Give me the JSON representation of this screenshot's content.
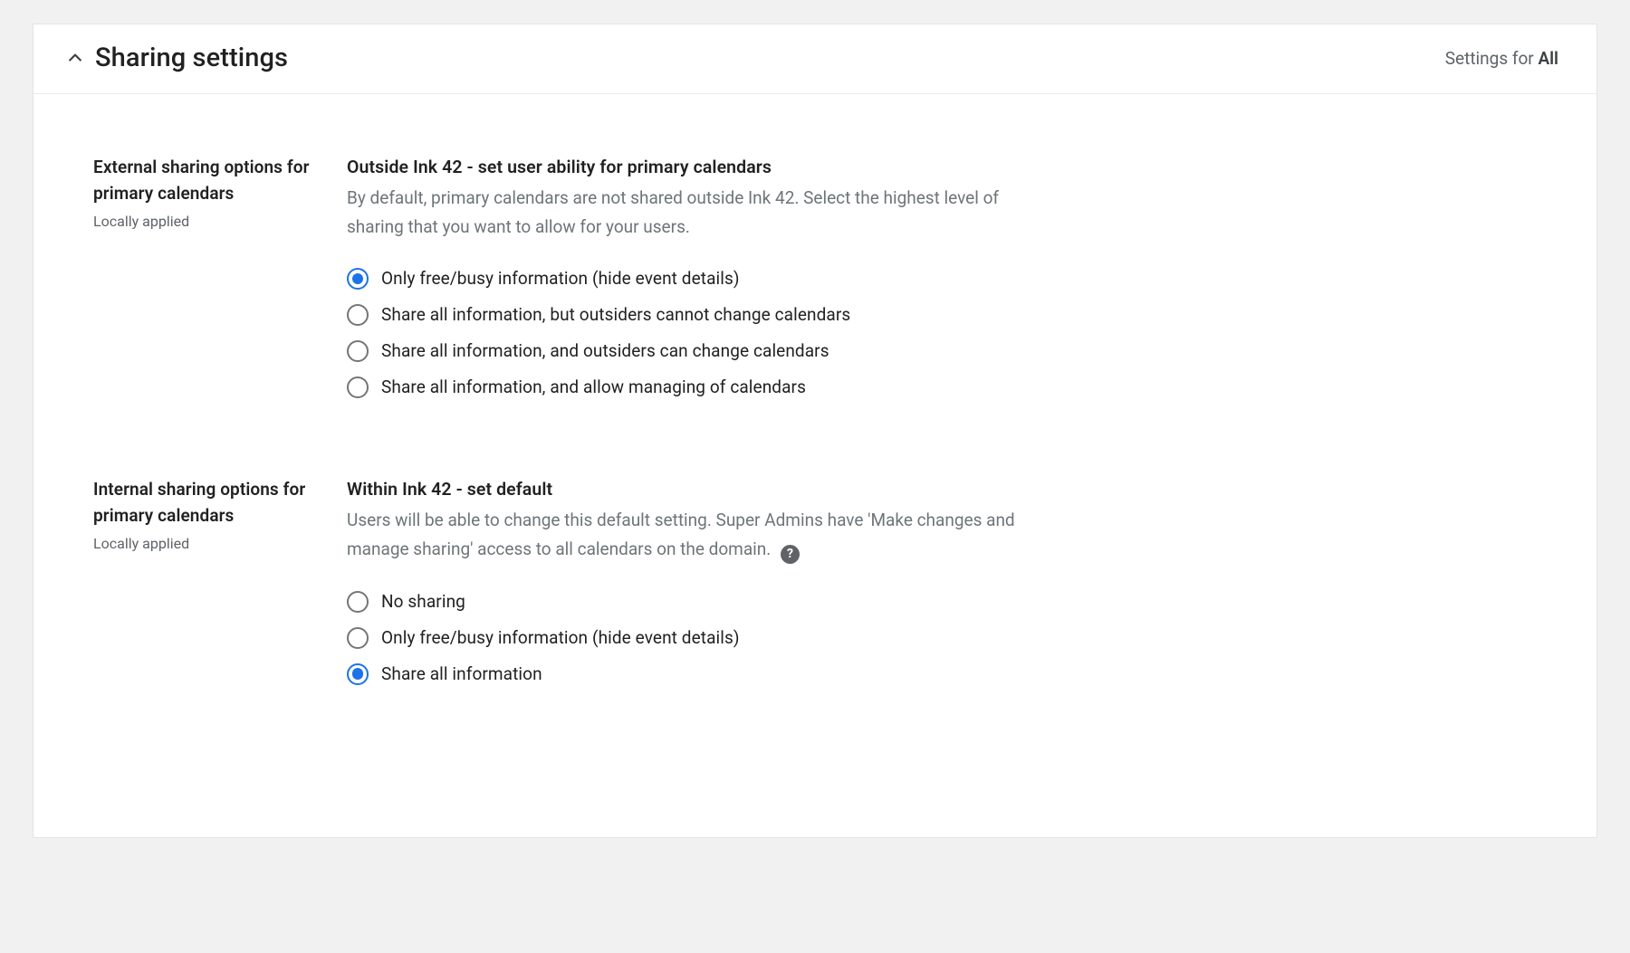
{
  "header": {
    "title": "Sharing settings",
    "settings_for_prefix": "Settings for ",
    "settings_for_value": "All"
  },
  "sections": {
    "external": {
      "left_title": "External sharing options for primary calendars",
      "locally_applied": "Locally applied",
      "heading": "Outside Ink 42 - set user ability for primary calendars",
      "description": "By default, primary calendars are not shared outside Ink 42. Select the highest level of sharing that you want to allow for your users.",
      "options": [
        "Only free/busy information (hide event details)",
        "Share all information, but outsiders cannot change calendars",
        "Share all information, and outsiders can change calendars",
        "Share all information, and allow managing of calendars"
      ],
      "selected_index": 0
    },
    "internal": {
      "left_title": "Internal sharing options for primary calendars",
      "locally_applied": "Locally applied",
      "heading": "Within Ink 42 - set default",
      "description": "Users will be able to change this default setting. Super Admins have 'Make changes and manage sharing' access to all calendars on the domain.",
      "options": [
        "No sharing",
        "Only free/busy information (hide event details)",
        "Share all information"
      ],
      "selected_index": 2
    }
  }
}
